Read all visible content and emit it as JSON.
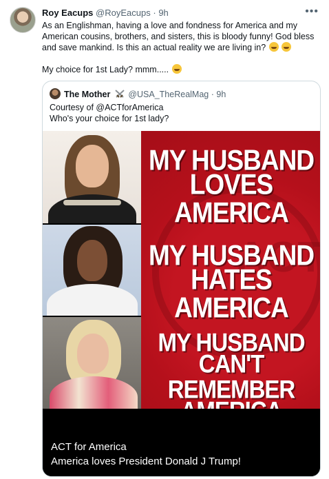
{
  "tweet": {
    "author_name": "Roy Eacups",
    "author_handle": "@RoyEacups",
    "separator": "·",
    "time": "9h",
    "more_icon": "more-horizontal-icon",
    "text_line1": "As an Englishman, having a love and fondness for America and my",
    "text_line2": "American cousins, brothers, and sisters, this is bloody funny! God bless",
    "text_line3": "and save mankind. Is this an actual reality we are living in?",
    "text_line4": "My choice for 1st Lady? mmm.....",
    "emojis": [
      "rolling-on-floor-laughing-emoji",
      "tears-of-joy-emoji",
      "grinning-emoji"
    ]
  },
  "quote": {
    "author_name": "The Mother",
    "author_handle": "@USA_TheRealMag",
    "separator": "·",
    "time": "9h",
    "badge_icon": "crossed-swords-icon",
    "text_line1": "Courtesy of @ACTforAmerica",
    "text_line2": "Who's your choice for 1st lady?",
    "image": {
      "headline1_a": "MY HUSBAND",
      "headline1_b": "LOVES AMERICA",
      "headline2_a": "MY HUSBAND",
      "headline2_b": "HATES AMERICA",
      "headline3_a": "MY HUSBAND",
      "headline3_b": "CAN'T REMEMBER",
      "headline3_c": "AMERICA",
      "watermark": "ACT",
      "caption_title": "ACT for America",
      "caption_text": "America loves President Donald J Trump!"
    }
  },
  "colors": {
    "text": "#0f1419",
    "secondary": "#536471",
    "border": "#cfd9de",
    "panel_red": "#b5101b"
  }
}
